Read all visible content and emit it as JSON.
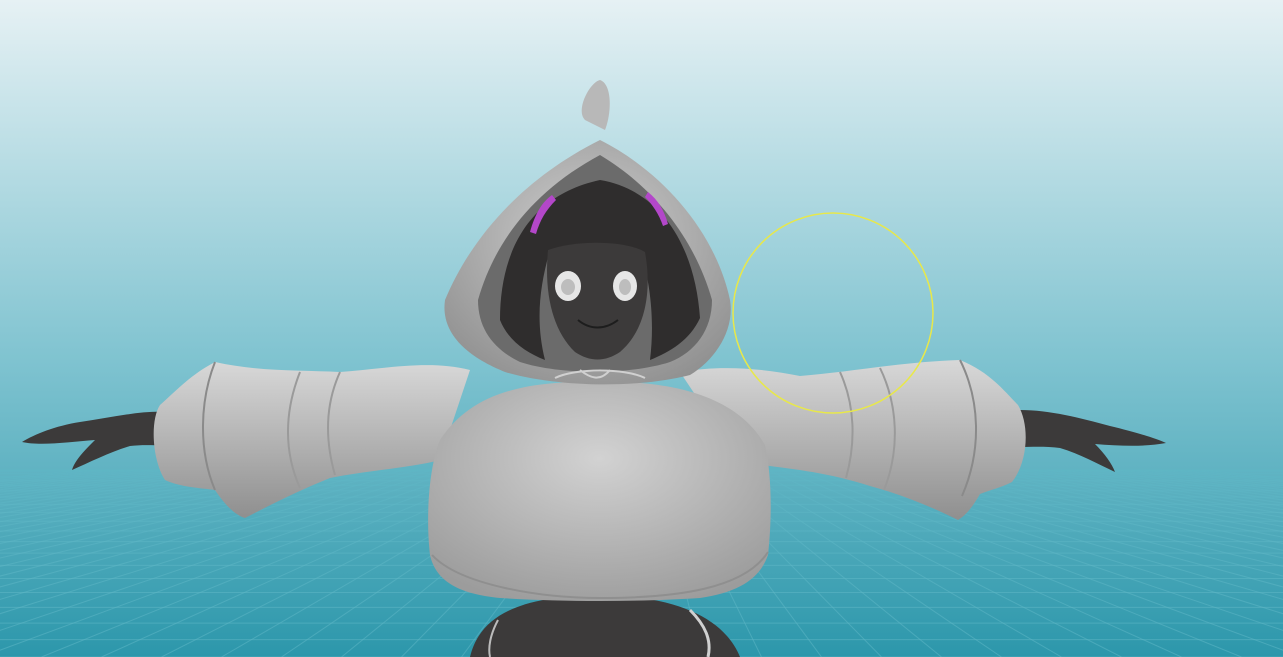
{
  "viewport": {
    "background_top": "#e6f1f4",
    "background_mid": "#7fc3d0",
    "background_bottom": "#2c97ab",
    "grid_color": "#5fb7c6",
    "brush_cursor_color": "#e8e84a"
  },
  "model": {
    "hood_color": "#c4c4c4",
    "skin_color": "#3c3a3a",
    "hair_color": "#2f2d2d",
    "accent_color": "#b347c9",
    "eye_color": "#e6e6e6"
  }
}
